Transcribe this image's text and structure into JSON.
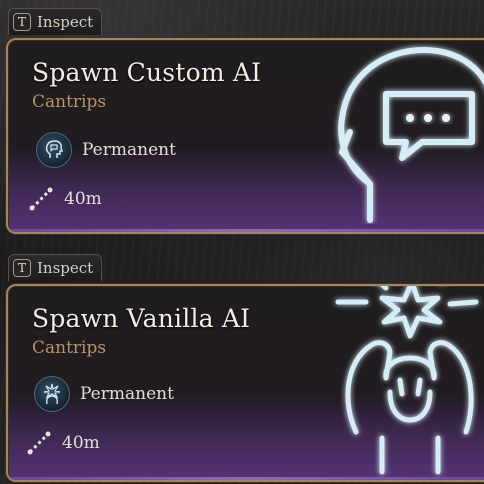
{
  "tooltips": [
    {
      "inspect_key": "T",
      "inspect_label": "Inspect",
      "title": "Spawn Custom AI",
      "category": "Cantrips",
      "duration_label": "Permanent",
      "range_label": "40m",
      "spell_icon": "head-speech-bubble-icon"
    },
    {
      "inspect_key": "T",
      "inspect_label": "Inspect",
      "title": "Spawn Vanilla AI",
      "category": "Cantrips",
      "duration_label": "Permanent",
      "range_label": "40m",
      "spell_icon": "burst-figure-icon"
    }
  ],
  "colors": {
    "accent_gold": "#b89368",
    "border_gold": "#a38463",
    "icon_glow": "#cfe6f2",
    "footer_purple": "#5a3a7e"
  }
}
